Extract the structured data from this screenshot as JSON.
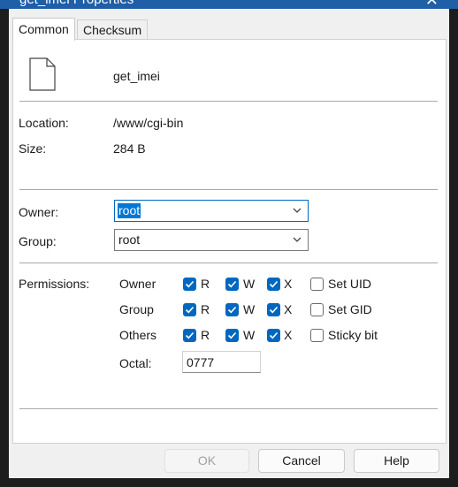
{
  "window": {
    "title": "get_imei Properties"
  },
  "tabs": [
    {
      "label": "Common",
      "selected": true
    },
    {
      "label": "Checksum",
      "selected": false
    }
  ],
  "file": {
    "name": "get_imei"
  },
  "info": {
    "location_label": "Location:",
    "location_value": "/www/cgi-bin",
    "size_label": "Size:",
    "size_value": "284 B"
  },
  "ownership": {
    "owner_label": "Owner:",
    "owner_value": "root",
    "group_label": "Group:",
    "group_value": "root"
  },
  "permissions": {
    "label": "Permissions:",
    "rows": [
      {
        "name": "Owner",
        "r": true,
        "w": true,
        "x": true,
        "special": "Set UID",
        "special_checked": false
      },
      {
        "name": "Group",
        "r": true,
        "w": true,
        "x": true,
        "special": "Set GID",
        "special_checked": false
      },
      {
        "name": "Others",
        "r": true,
        "w": true,
        "x": true,
        "special": "Sticky bit",
        "special_checked": false
      }
    ],
    "r_label": "R",
    "w_label": "W",
    "x_label": "X",
    "octal_label": "Octal:",
    "octal_value": "0777"
  },
  "buttons": {
    "ok": "OK",
    "cancel": "Cancel",
    "help": "Help"
  },
  "colors": {
    "accent": "#0067c0",
    "selection": "#0078d7"
  }
}
